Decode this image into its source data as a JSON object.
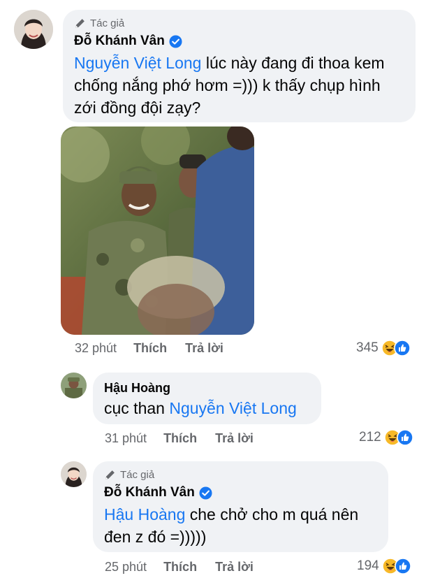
{
  "comments": [
    {
      "author_tag": "Tác giả",
      "name": "Đỗ Khánh Vân",
      "mention": "Nguyễn Việt Long",
      "text_line1_rest": " lúc này đang đi thoa kem",
      "text_line2": "chống nắng phớ hơm =))) k thấy chụp hình",
      "text_line3": "zới đồng đội zạy?",
      "time": "32 phút",
      "like_label": "Thích",
      "reply_label": "Trả lời",
      "reactions": "345"
    },
    {
      "name": "Hậu Hoàng",
      "text_prefix": "cục than ",
      "mention": "Nguyễn Việt Long",
      "time": "31 phút",
      "like_label": "Thích",
      "reply_label": "Trả lời",
      "reactions": "212"
    },
    {
      "author_tag": "Tác giả",
      "name": "Đỗ Khánh Vân",
      "mention": "Hậu Hoàng",
      "text_line1_rest": " che chở cho m quá nên",
      "text_line2": "đen z đó =)))))",
      "time": "25 phút",
      "like_label": "Thích",
      "reply_label": "Trả lời",
      "reactions": "194"
    }
  ],
  "icons": {
    "author": "pencil-icon",
    "verified": "verified-badge-icon",
    "haha": "haha-reaction-icon",
    "like": "like-reaction-icon"
  },
  "colors": {
    "mention": "#1877f2",
    "bubble": "#f0f2f5",
    "meta": "#65676b"
  }
}
